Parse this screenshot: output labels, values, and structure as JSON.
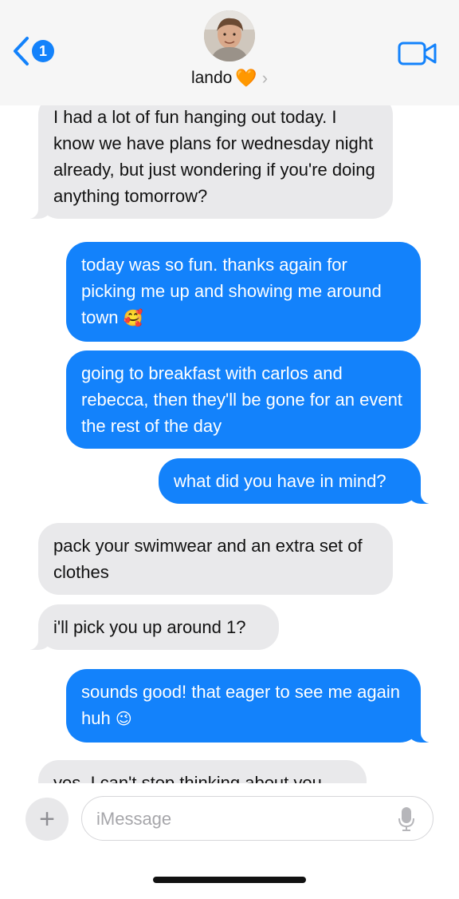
{
  "header": {
    "back_count": "1",
    "contact_name": "lando",
    "contact_emoji": "🧡",
    "accent_color": "#1382fb"
  },
  "messages": [
    {
      "direction": "incoming",
      "text": "I had a lot of fun hanging out today. I know we have plans for wednesday night already, but just wondering if you're doing anything tomorrow?"
    },
    {
      "direction": "outgoing",
      "text": "today was so fun. thanks again for picking me up and showing me around town",
      "emoji": "🥰"
    },
    {
      "direction": "outgoing",
      "text": "going to breakfast with carlos and rebecca, then they'll be gone for an event the rest of the day"
    },
    {
      "direction": "outgoing",
      "text": "what did you have in mind?"
    },
    {
      "direction": "incoming",
      "text": "pack your swimwear and an extra set of clothes"
    },
    {
      "direction": "incoming",
      "text": "i'll pick you up around 1?"
    },
    {
      "direction": "outgoing",
      "text": "sounds good! that eager to see me again huh",
      "emoji": "😉"
    },
    {
      "direction": "incoming",
      "text": "yes. I can't stop thinking about you"
    }
  ],
  "input": {
    "placeholder": "iMessage",
    "value": ""
  },
  "icons": {
    "back": "chevron-left-icon",
    "video": "video-camera-icon",
    "add": "plus-icon",
    "mic": "microphone-icon"
  }
}
